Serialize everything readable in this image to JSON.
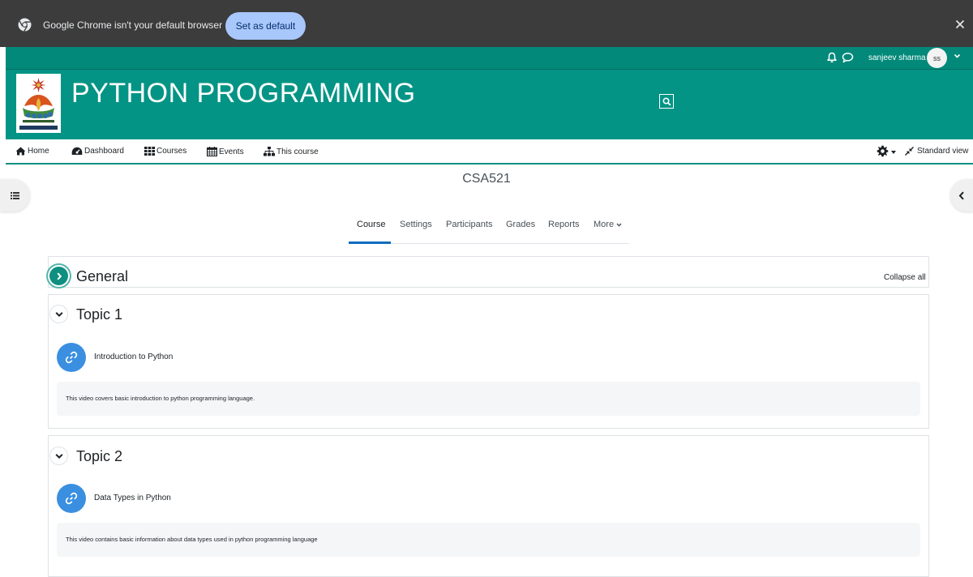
{
  "browser_notice": {
    "message": "Google Chrome isn't your default browser",
    "button": "Set as default"
  },
  "user": {
    "name": "sanjeev sharma",
    "initials": "ss"
  },
  "site": {
    "title": "PYTHON PROGRAMMING"
  },
  "nav": {
    "home": "Home",
    "dashboard": "Dashboard",
    "courses": "Courses",
    "events": "Events",
    "this_course": "This course",
    "standard_view": "Standard view"
  },
  "course": {
    "shortname": "CSA521"
  },
  "tabs": {
    "course": "Course",
    "settings": "Settings",
    "participants": "Participants",
    "grades": "Grades",
    "reports": "Reports",
    "more": "More"
  },
  "sections": {
    "general": {
      "title": "General",
      "collapse_all": "Collapse all"
    },
    "topic1": {
      "title": "Topic 1",
      "activity": "Introduction to Python",
      "description": "This video covers basic introduction to python programming language."
    },
    "topic2": {
      "title": "Topic 2",
      "activity": "Data Types in Python",
      "description": "This video contains basic information about data types used in python programming language"
    }
  },
  "colors": {
    "theme_teal": "#039485",
    "activity_blue": "#3a8fe0",
    "chrome_bar": "#3c3c3c"
  }
}
